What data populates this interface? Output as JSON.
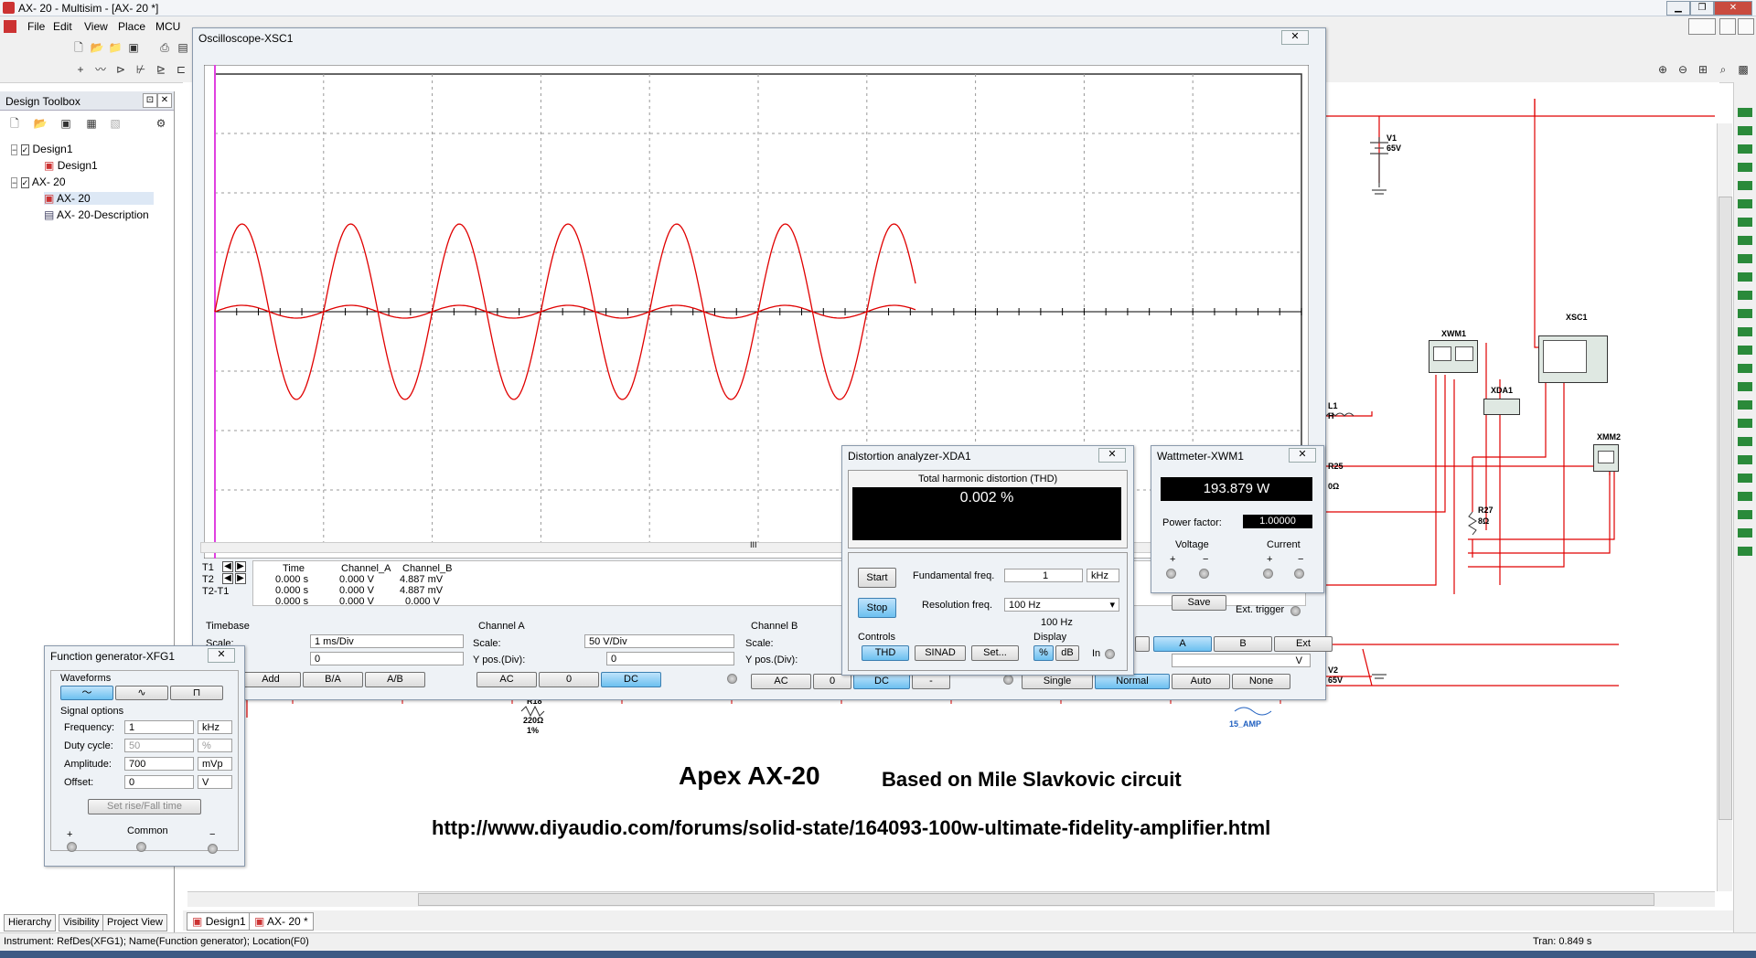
{
  "app": {
    "title": "AX- 20 - Multisim - [AX- 20 *]",
    "menu": [
      "File",
      "Edit",
      "View",
      "Place",
      "MCU"
    ]
  },
  "toolbox": {
    "title": "Design Toolbox",
    "tree": [
      {
        "label": "Design1",
        "children": [
          {
            "label": "Design1"
          }
        ]
      },
      {
        "label": "AX- 20",
        "children": [
          {
            "label": "AX- 20"
          },
          {
            "label": "AX- 20-Description"
          }
        ]
      }
    ],
    "tabs": [
      "Hierarchy",
      "Visibility",
      "Project View"
    ]
  },
  "doc_tabs": [
    "Design1",
    "AX- 20 *"
  ],
  "status": {
    "left": "Instrument: RefDes(XFG1); Name(Function generator); Location(F0)",
    "right": "Tran: 0.849 s"
  },
  "oscilloscope": {
    "title": "Oscilloscope-XSC1",
    "close": "✕",
    "readout": {
      "headers": [
        "Time",
        "Channel_A",
        "Channel_B"
      ],
      "rows": [
        {
          "label": "T1",
          "time": "0.000 s",
          "a": "0.000 V",
          "b": "4.887 mV"
        },
        {
          "label": "T2",
          "time": "0.000 s",
          "a": "0.000 V",
          "b": "4.887 mV"
        },
        {
          "label": "T2-T1",
          "time": "0.000 s",
          "a": "0.000 V",
          "b": "0.000 V"
        }
      ]
    },
    "timebase": {
      "title": "Timebase",
      "scale_label": "Scale:",
      "scale": "1 ms/Div",
      "xpos": "0",
      "buttons": [
        "Add",
        "B/A",
        "A/B"
      ]
    },
    "channel_a": {
      "title": "Channel A",
      "scale_label": "Scale:",
      "scale": "50  V/Div",
      "ypos_label": "Y pos.(Div):",
      "ypos": "0",
      "buttons": [
        "AC",
        "0",
        "DC"
      ]
    },
    "channel_b": {
      "title": "Channel B",
      "scale_label": "Scale:",
      "ypos_label": "Y pos.(Div):",
      "buttons": [
        "AC",
        "0",
        "DC",
        "-"
      ]
    },
    "trigger": {
      "save": "Save",
      "ext": "Ext. trigger",
      "source": [
        "A",
        "B",
        "Ext"
      ],
      "level_unit": "V",
      "modes": [
        "Single",
        "Normal",
        "Auto",
        "None"
      ]
    },
    "scroll_mark": "III"
  },
  "distortion": {
    "title": "Distortion analyzer-XDA1",
    "heading": "Total harmonic distortion (THD)",
    "value": "0.002 %",
    "start": "Start",
    "stop": "Stop",
    "fund_label": "Fundamental freq.",
    "fund_value": "1",
    "fund_unit": "kHz",
    "res_label": "Resolution freq.",
    "res_value": "100 Hz",
    "res_value2": "100 Hz",
    "controls_label": "Controls",
    "controls": [
      "THD",
      "SINAD",
      "Set..."
    ],
    "display_label": "Display",
    "display": [
      "%",
      "dB"
    ],
    "in_label": "In"
  },
  "wattmeter": {
    "title": "Wattmeter-XWM1",
    "value": "193.879 W",
    "pf_label": "Power factor:",
    "pf_value": "1.00000",
    "voltage": "Voltage",
    "current": "Current",
    "plus": "+",
    "minus": "−"
  },
  "funcgen": {
    "title": "Function generator-XFG1",
    "waveforms_label": "Waveforms",
    "signal_label": "Signal options",
    "rows": [
      {
        "label": "Frequency:",
        "value": "1",
        "unit": "kHz"
      },
      {
        "label": "Duty cycle:",
        "value": "50",
        "unit": "%"
      },
      {
        "label": "Amplitude:",
        "value": "700",
        "unit": "mVp"
      },
      {
        "label": "Offset:",
        "value": "0",
        "unit": "V"
      }
    ],
    "rise_btn": "Set rise/Fall time",
    "plus": "+",
    "common": "Common",
    "minus": "−"
  },
  "schematic": {
    "heading": "Apex AX-20",
    "subheading": "Based on Mile Slavkovic circuit",
    "url": "http://www.diyaudio.com/forums/solid-state/164093-100w-ultimate-fidelity-amplifier.html",
    "labels": {
      "v1": "V1",
      "v1_val": "65V",
      "v2": "V2",
      "v2_val": "65V",
      "xwm1": "XWM1",
      "xsc1": "XSC1",
      "xda1": "XDA1",
      "xmm2": "XMM2",
      "l1": "L1",
      "l1_val": "H",
      "r25": "R25",
      "r25_val": "0Ω",
      "r27": "R27",
      "r27_val": "8Ω",
      "r18": "R18",
      "r18_val": "220Ω",
      "r18_tol": "1%",
      "amp": "15_AMP"
    }
  },
  "colors": {
    "trace": "#e00000",
    "wire": "#e00000",
    "cursor": "#e040e0",
    "accent": "#6cc0f0"
  }
}
